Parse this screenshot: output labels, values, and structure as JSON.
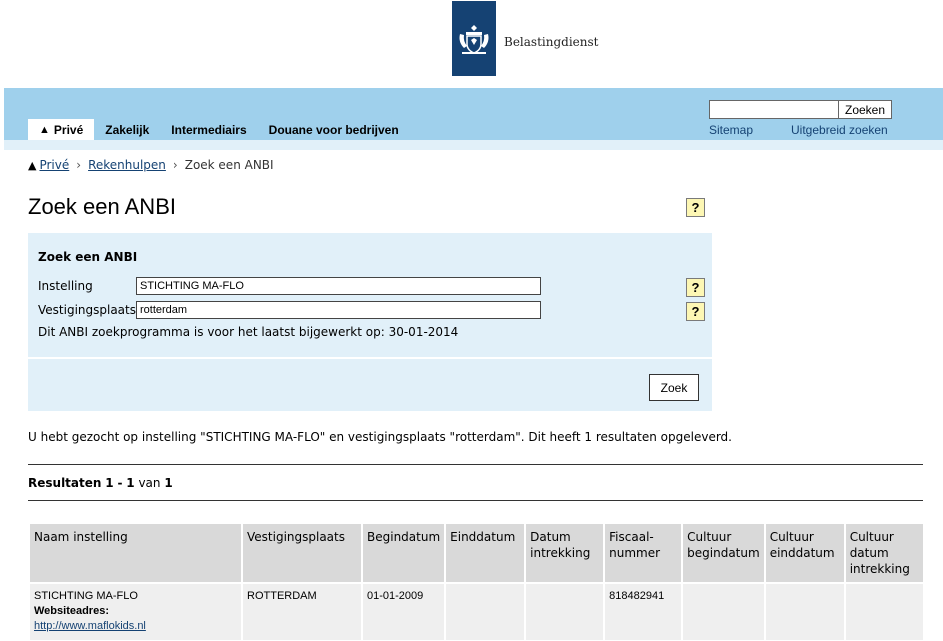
{
  "header": {
    "brand": "Belastingdienst"
  },
  "nav": {
    "tabs": [
      {
        "label": "Privé",
        "active": true
      },
      {
        "label": "Zakelijk",
        "active": false
      },
      {
        "label": "Intermediairs",
        "active": false
      },
      {
        "label": "Douane voor bedrijven",
        "active": false
      }
    ],
    "search_value": "",
    "search_button": "Zoeken",
    "sitemap": "Sitemap",
    "advanced_search": "Uitgebreid zoeken"
  },
  "breadcrumb": {
    "items": [
      "Privé",
      "Rekenhulpen",
      "Zoek een ANBI"
    ],
    "separator": "›"
  },
  "page": {
    "title": "Zoek een ANBI",
    "help": "?"
  },
  "form": {
    "heading": "Zoek een ANBI",
    "instelling_label": "Instelling",
    "instelling_value": "STICHTING MA-FLO",
    "vestigingsplaats_label": "Vestigingsplaats",
    "vestigingsplaats_value": "rotterdam",
    "update_note": "Dit ANBI zoekprogramma is voor het laatst bijgewerkt op: 30-01-2014",
    "submit": "Zoek"
  },
  "results": {
    "summary": "U hebt gezocht op instelling \"STICHTING MA-FLO\" en vestigingsplaats \"rotterdam\". Dit heeft 1 resultaten opgeleverd.",
    "count_prefix": "Resultaten",
    "count_from": "1",
    "count_dash": "-",
    "count_to": "1",
    "count_of": "van",
    "count_total": "1",
    "columns": [
      [
        "Naam instelling"
      ],
      [
        "Vestigingsplaats"
      ],
      [
        "Begindatum"
      ],
      [
        "Einddatum"
      ],
      [
        "Datum",
        "intrekking"
      ],
      [
        "Fiscaal-",
        "nummer"
      ],
      [
        "Cultuur",
        "begindatum"
      ],
      [
        "Cultuur",
        "einddatum"
      ],
      [
        "Cultuur",
        "datum",
        "intrekking"
      ]
    ],
    "row": {
      "naam": "STICHTING MA-FLO",
      "website_label": "Websiteadres:",
      "website": "http://www.maflokids.nl",
      "vestigingsplaats": "ROTTERDAM",
      "begindatum": "01-01-2009",
      "einddatum": "",
      "datum_intrekking": "",
      "fiscaalnummer": "818482941",
      "cultuur_begindatum": "",
      "cultuur_einddatum": "",
      "cultuur_datum_intrekking": ""
    }
  },
  "colors": {
    "brand_blue": "#154273",
    "nav_band": "#9fd0ec",
    "panel": "#e1f0f9",
    "help_yellow": "#fdf7b4"
  }
}
